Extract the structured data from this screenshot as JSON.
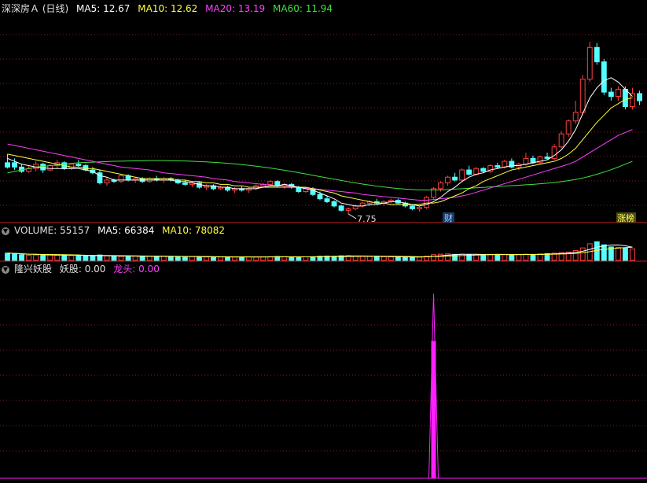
{
  "colors": {
    "up": "#ff4040",
    "down": "#54ffff",
    "ma5": "#ffffff",
    "ma10": "#ffff40",
    "ma20": "#ff40ff",
    "ma60": "#40e040",
    "divider": "#c02020",
    "grid": "#8b1a1a",
    "text": "#e0e0e0",
    "signal": "#ff20ff"
  },
  "main_legend": {
    "title": "深深房Ａ (日线)",
    "ma5": "MA5: 12.67",
    "ma10": "MA10: 12.62",
    "ma20": "MA20: 13.19",
    "ma60": "MA60: 11.94"
  },
  "vol_legend": {
    "title": "VOLUME: 55157",
    "ma5": "MA5: 66384",
    "ma10": "MA10: 78082"
  },
  "ind_legend": {
    "title": "隆兴妖股",
    "yaogu": "妖股: 0.00",
    "longtou": "龙头: 0.00"
  },
  "annotations": {
    "low_price": "7.75",
    "cai_marker": "财",
    "last_marker": "涨榜"
  },
  "chart_data": [
    {
      "type": "candlestick",
      "name": "price",
      "title": "深深房Ａ (日线)",
      "low_label": "7.75",
      "candles": [
        [
          11,
          11.9,
          10.9,
          11.3,
          "d"
        ],
        [
          11.3,
          11.6,
          10.8,
          11.0,
          "d"
        ],
        [
          11.0,
          11.2,
          10.6,
          10.7,
          "d"
        ],
        [
          10.7,
          11.1,
          10.6,
          10.9,
          "u"
        ],
        [
          10.9,
          11.4,
          10.7,
          11.2,
          "u"
        ],
        [
          11.2,
          11.3,
          10.6,
          10.8,
          "d"
        ],
        [
          10.8,
          11.2,
          10.7,
          11.1,
          "u"
        ],
        [
          11.1,
          11.5,
          10.9,
          11.3,
          "u"
        ],
        [
          11.3,
          11.4,
          10.8,
          10.9,
          "d"
        ],
        [
          10.9,
          11.3,
          10.8,
          11.2,
          "u"
        ],
        [
          11.2,
          11.5,
          11.0,
          11.1,
          "d"
        ],
        [
          11.1,
          11.2,
          10.7,
          10.8,
          "d"
        ],
        [
          10.8,
          11.0,
          10.5,
          10.6,
          "d"
        ],
        [
          10.6,
          10.8,
          9.8,
          9.9,
          "d"
        ],
        [
          9.9,
          10.3,
          9.7,
          10.1,
          "u"
        ],
        [
          10.1,
          10.2,
          9.9,
          10.0,
          "d"
        ],
        [
          10.0,
          10.5,
          9.9,
          10.4,
          "u"
        ],
        [
          10.4,
          10.5,
          10.0,
          10.1,
          "d"
        ],
        [
          10.1,
          10.3,
          9.9,
          10.2,
          "u"
        ],
        [
          10.2,
          10.3,
          9.9,
          10.0,
          "d"
        ],
        [
          10.0,
          10.3,
          9.9,
          10.2,
          "u"
        ],
        [
          10.2,
          10.4,
          10.0,
          10.1,
          "d"
        ],
        [
          10.1,
          10.3,
          9.9,
          10.2,
          "u"
        ],
        [
          10.2,
          10.3,
          10.0,
          10.1,
          "d"
        ],
        [
          10.1,
          10.2,
          9.8,
          9.9,
          "d"
        ],
        [
          9.9,
          10.1,
          9.7,
          9.8,
          "d"
        ],
        [
          9.8,
          10.0,
          9.6,
          9.9,
          "u"
        ],
        [
          9.9,
          10.0,
          9.5,
          9.6,
          "d"
        ],
        [
          9.6,
          9.8,
          9.4,
          9.7,
          "u"
        ],
        [
          9.7,
          9.8,
          9.4,
          9.5,
          "d"
        ],
        [
          9.5,
          9.7,
          9.4,
          9.6,
          "u"
        ],
        [
          9.6,
          9.7,
          9.3,
          9.4,
          "d"
        ],
        [
          9.4,
          9.6,
          9.2,
          9.5,
          "u"
        ],
        [
          9.5,
          9.7,
          9.3,
          9.4,
          "d"
        ],
        [
          9.4,
          9.6,
          9.2,
          9.5,
          "u"
        ],
        [
          9.5,
          9.8,
          9.4,
          9.7,
          "u"
        ],
        [
          9.7,
          9.9,
          9.6,
          9.8,
          "u"
        ],
        [
          9.8,
          10.1,
          9.7,
          10.0,
          "u"
        ],
        [
          10.0,
          10.1,
          9.6,
          9.7,
          "d"
        ],
        [
          9.7,
          9.9,
          9.5,
          9.8,
          "u"
        ],
        [
          9.8,
          9.9,
          9.5,
          9.6,
          "d"
        ],
        [
          9.6,
          9.7,
          9.2,
          9.3,
          "d"
        ],
        [
          9.3,
          9.6,
          9.2,
          9.5,
          "u"
        ],
        [
          9.5,
          9.6,
          9.0,
          9.1,
          "d"
        ],
        [
          9.1,
          9.3,
          8.7,
          8.8,
          "d"
        ],
        [
          8.8,
          9.0,
          8.5,
          8.6,
          "d"
        ],
        [
          8.6,
          8.7,
          8.2,
          8.3,
          "d"
        ],
        [
          8.3,
          8.4,
          7.9,
          8.0,
          "d"
        ],
        [
          8.0,
          8.2,
          7.75,
          8.1,
          "u"
        ],
        [
          8.1,
          8.4,
          8.0,
          8.3,
          "u"
        ],
        [
          8.3,
          8.6,
          8.2,
          8.5,
          "u"
        ],
        [
          8.5,
          8.7,
          8.3,
          8.6,
          "u"
        ],
        [
          8.6,
          8.8,
          8.4,
          8.5,
          "d"
        ],
        [
          8.5,
          8.7,
          8.3,
          8.6,
          "u"
        ],
        [
          8.6,
          8.8,
          8.5,
          8.7,
          "u"
        ],
        [
          8.7,
          8.8,
          8.4,
          8.5,
          "d"
        ],
        [
          8.5,
          8.6,
          8.2,
          8.3,
          "d"
        ],
        [
          8.3,
          8.4,
          8.0,
          8.1,
          "d"
        ],
        [
          8.1,
          8.3,
          7.9,
          8.2,
          "u"
        ],
        [
          8.2,
          9.0,
          8.1,
          8.9,
          "u"
        ],
        [
          8.9,
          9.6,
          8.8,
          9.5,
          "u"
        ],
        [
          9.5,
          10.0,
          9.3,
          9.9,
          "u"
        ],
        [
          9.9,
          10.4,
          9.7,
          10.3,
          "u"
        ],
        [
          10.3,
          10.6,
          10.0,
          10.1,
          "d"
        ],
        [
          10.1,
          10.9,
          10.0,
          10.8,
          "u"
        ],
        [
          10.8,
          11.1,
          10.4,
          10.5,
          "d"
        ],
        [
          10.5,
          11.0,
          10.4,
          10.9,
          "u"
        ],
        [
          10.9,
          11.0,
          10.6,
          10.7,
          "d"
        ],
        [
          10.7,
          11.2,
          10.6,
          11.1,
          "u"
        ],
        [
          11.1,
          11.3,
          10.9,
          11.0,
          "d"
        ],
        [
          11.0,
          11.5,
          10.9,
          11.4,
          "u"
        ],
        [
          11.4,
          11.6,
          10.9,
          11.0,
          "d"
        ],
        [
          11.0,
          11.3,
          10.8,
          11.2,
          "u"
        ],
        [
          11.2,
          12.0,
          11.1,
          11.6,
          "u"
        ],
        [
          11.6,
          11.8,
          11.2,
          11.3,
          "d"
        ],
        [
          11.3,
          11.8,
          11.2,
          11.7,
          "u"
        ],
        [
          11.7,
          12.0,
          11.5,
          11.6,
          "d"
        ],
        [
          11.6,
          12.6,
          11.5,
          12.4,
          "u"
        ],
        [
          12.4,
          13.5,
          12.3,
          13.3,
          "u"
        ],
        [
          13.3,
          14.3,
          13.1,
          14.2,
          "u"
        ],
        [
          14.2,
          15.6,
          14.0,
          14.8,
          "u"
        ],
        [
          14.8,
          17.4,
          14.6,
          17.1,
          "u"
        ],
        [
          17.1,
          19.7,
          16.9,
          19.3,
          "u"
        ],
        [
          19.3,
          19.6,
          18.1,
          18.3,
          "d"
        ],
        [
          18.3,
          18.5,
          16.0,
          16.2,
          "d"
        ],
        [
          16.2,
          16.5,
          15.6,
          15.9,
          "d"
        ],
        [
          15.9,
          16.6,
          15.6,
          16.4,
          "u"
        ],
        [
          16.4,
          16.6,
          15.0,
          15.2,
          "d"
        ],
        [
          15.2,
          16.5,
          15.0,
          16.1,
          "u"
        ],
        [
          16.1,
          16.3,
          15.3,
          15.6,
          "d"
        ]
      ],
      "ma5": [
        11.6,
        11.4,
        11.2,
        11.1,
        11.0,
        10.96,
        10.9,
        10.9,
        10.9,
        10.9,
        10.9,
        10.8,
        10.7,
        10.4,
        10.3,
        10.1,
        10.1,
        10.1,
        10.1,
        10.1,
        10.1,
        10.1,
        10.1,
        10.1,
        10.0,
        10.0,
        9.9,
        9.8,
        9.7,
        9.7,
        9.6,
        9.6,
        9.5,
        9.5,
        9.5,
        9.5,
        9.6,
        9.7,
        9.7,
        9.8,
        9.7,
        9.6,
        9.5,
        9.4,
        9.2,
        9.0,
        8.8,
        8.5,
        8.4,
        8.3,
        8.3,
        8.4,
        8.4,
        8.5,
        8.6,
        8.6,
        8.5,
        8.4,
        8.3,
        8.4,
        8.6,
        8.9,
        9.3,
        9.6,
        10.0,
        10.3,
        10.5,
        10.6,
        10.8,
        10.9,
        11.0,
        11.1,
        11.1,
        11.2,
        11.3,
        11.4,
        11.5,
        11.8,
        12.2,
        12.8,
        13.6,
        14.7,
        15.8,
        16.5,
        17.0,
        17.2,
        16.9,
        16.4,
        15.9
      ],
      "ma10": [
        11.9,
        11.8,
        11.7,
        11.6,
        11.5,
        11.4,
        11.3,
        11.2,
        11.1,
        11.0,
        11.0,
        10.9,
        10.9,
        10.8,
        10.7,
        10.6,
        10.5,
        10.4,
        10.3,
        10.2,
        10.2,
        10.2,
        10.2,
        10.2,
        10.1,
        10.1,
        10.0,
        10.0,
        9.9,
        9.9,
        9.8,
        9.8,
        9.7,
        9.7,
        9.6,
        9.6,
        9.6,
        9.6,
        9.6,
        9.6,
        9.6,
        9.6,
        9.6,
        9.5,
        9.4,
        9.3,
        9.2,
        9.0,
        8.9,
        8.8,
        8.7,
        8.6,
        8.5,
        8.5,
        8.4,
        8.4,
        8.4,
        8.4,
        8.4,
        8.5,
        8.5,
        8.6,
        8.8,
        9.0,
        9.2,
        9.5,
        9.7,
        10.0,
        10.2,
        10.4,
        10.6,
        10.8,
        10.9,
        11.0,
        11.1,
        11.2,
        11.3,
        11.4,
        11.6,
        11.9,
        12.3,
        12.9,
        13.5,
        14.1,
        14.6,
        15.1,
        15.4,
        15.7,
        15.8
      ],
      "ma20": [
        12.6,
        12.5,
        12.4,
        12.3,
        12.2,
        12.1,
        12.0,
        11.9,
        11.8,
        11.7,
        11.6,
        11.5,
        11.4,
        11.3,
        11.2,
        11.1,
        11.0,
        10.95,
        10.9,
        10.85,
        10.8,
        10.7,
        10.6,
        10.55,
        10.5,
        10.45,
        10.4,
        10.35,
        10.3,
        10.2,
        10.15,
        10.1,
        10.0,
        9.95,
        9.9,
        9.85,
        9.8,
        9.75,
        9.7,
        9.7,
        9.65,
        9.6,
        9.55,
        9.5,
        9.45,
        9.4,
        9.35,
        9.3,
        9.25,
        9.2,
        9.1,
        9.05,
        9.0,
        8.95,
        8.9,
        8.85,
        8.8,
        8.75,
        8.7,
        8.7,
        8.75,
        8.8,
        8.85,
        8.9,
        9.0,
        9.1,
        9.25,
        9.4,
        9.55,
        9.7,
        9.85,
        10.0,
        10.15,
        10.3,
        10.45,
        10.6,
        10.75,
        10.9,
        11.05,
        11.2,
        11.4,
        11.7,
        12.0,
        12.3,
        12.6,
        12.9,
        13.2,
        13.4,
        13.6
      ],
      "ma60": [
        10.6,
        10.7,
        10.8,
        10.9,
        11.0,
        11.05,
        11.1,
        11.15,
        11.2,
        11.25,
        11.3,
        11.32,
        11.34,
        11.36,
        11.38,
        11.4,
        11.41,
        11.42,
        11.43,
        11.44,
        11.45,
        11.45,
        11.45,
        11.44,
        11.43,
        11.42,
        11.4,
        11.38,
        11.36,
        11.33,
        11.3,
        11.26,
        11.22,
        11.17,
        11.12,
        11.06,
        11.0,
        10.93,
        10.86,
        10.78,
        10.7,
        10.61,
        10.52,
        10.43,
        10.34,
        10.25,
        10.16,
        10.07,
        9.98,
        9.9,
        9.82,
        9.75,
        9.68,
        9.62,
        9.56,
        9.51,
        9.47,
        9.44,
        9.42,
        9.41,
        9.41,
        9.42,
        9.44,
        9.47,
        9.5,
        9.53,
        9.56,
        9.59,
        9.62,
        9.65,
        9.68,
        9.71,
        9.74,
        9.77,
        9.8,
        9.84,
        9.88,
        9.93,
        9.99,
        10.06,
        10.14,
        10.24,
        10.36,
        10.5,
        10.65,
        10.82,
        11.0,
        11.2,
        11.4
      ],
      "ylim": [
        7.2,
        21.5
      ]
    },
    {
      "type": "bar",
      "name": "volume",
      "title": "VOLUME",
      "last": 55157,
      "ma5": 66384,
      "ma10": 78082,
      "values": [
        70,
        65,
        55,
        50,
        52,
        48,
        55,
        50,
        52,
        48,
        45,
        42,
        40,
        52,
        45,
        40,
        38,
        40,
        42,
        38,
        40,
        38,
        39,
        37,
        36,
        35,
        36,
        34,
        33,
        34,
        33,
        34,
        32,
        33,
        34,
        32,
        34,
        36,
        38,
        35,
        33,
        32,
        34,
        36,
        40,
        42,
        40,
        44,
        46,
        42,
        40,
        38,
        36,
        35,
        34,
        33,
        32,
        31,
        33,
        40,
        55,
        60,
        62,
        58,
        60,
        55,
        57,
        54,
        55,
        58,
        56,
        54,
        57,
        60,
        58,
        62,
        65,
        70,
        75,
        80,
        95,
        120,
        160,
        180,
        150,
        130,
        125,
        120,
        110
      ],
      "ylim": [
        0,
        220
      ]
    },
    {
      "type": "bar",
      "name": "indicator",
      "title": "隆兴妖股",
      "yaogu": 0.0,
      "longtou": 0.0,
      "signal_index": 60,
      "signal_value": 1.0,
      "ylim": [
        0,
        1.1
      ]
    }
  ]
}
